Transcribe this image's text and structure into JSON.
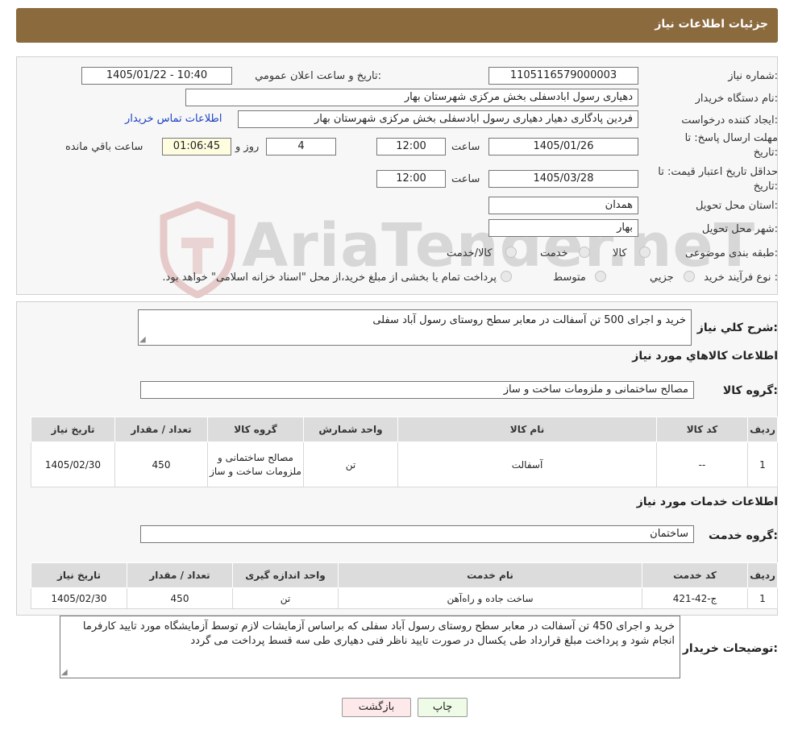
{
  "header": {
    "title": "جزئیات اطلاعات نیاز"
  },
  "watermark": {
    "text": "AriaTender.neT"
  },
  "form": {
    "need_number_label": "شماره نیاز:",
    "need_number": "1105116579000003",
    "announce_label": "تاریخ و ساعت اعلان عمومي:",
    "announce_value": "1405/01/22 - 10:40",
    "buyer_org_label": "نام دستگاه خریدار:",
    "buyer_org": "دهیاری رسول ابادسفلی بخش مرکزی شهرستان بهار",
    "requester_label": "ایجاد کننده درخواست:",
    "requester": "فردین پادگاری دهیار دهیاری رسول ابادسفلی بخش مرکزی شهرستان بهار",
    "contact_link": "اطلاعات تماس خریدار",
    "deadline_label_1": "مهلت ارسال پاسخ: تا",
    "deadline_label_2": "تاریخ:",
    "deadline_date": "1405/01/26",
    "time_word": "ساعت",
    "deadline_time": "12:00",
    "days_value": "4",
    "days_word": "روز و",
    "remaining_time": "01:06:45",
    "remaining_word": "ساعت باقي مانده",
    "validity_label_1": "حداقل تاریخ اعتبار قیمت: تا",
    "validity_label_2": "تاریخ:",
    "validity_date": "1405/03/28",
    "validity_time": "12:00",
    "province_label": "استان محل تحویل:",
    "province": "همدان",
    "city_label": "شهر محل تحویل:",
    "city": "بهار",
    "category_label": "طبقه بندی موضوعی:",
    "category_options": [
      "کالا",
      "خدمت",
      "کالا/خدمت"
    ],
    "process_label": "نوع فرآیند خرید :",
    "process_options": [
      "جزیي",
      "متوسط"
    ],
    "process_note": "پرداخت تمام یا بخشی از مبلغ خرید،از محل \"اسناد خزانه اسلامی\" خواهد بود."
  },
  "summary": {
    "label": "شرح کلي نیاز:",
    "text": "خرید و اجرای 500 تن آسفالت در معابر سطح روستای رسول آباد سفلی"
  },
  "goods": {
    "section_title": "اطلاعات کالاهاي مورد نیاز",
    "group_label": "گروه کالا:",
    "group_value": "مصالح ساختمانی و ملزومات ساخت و ساز",
    "headers": [
      "ردیف",
      "کد کالا",
      "نام کالا",
      "واحد شمارش",
      "گروه کالا",
      "تعداد / مقدار",
      "تاریخ نیاز"
    ],
    "rows": [
      [
        "1",
        "--",
        "آسفالت",
        "تن",
        "مصالح ساختمانی و ملزومات ساخت و ساز",
        "450",
        "1405/02/30"
      ]
    ]
  },
  "services": {
    "section_title": "اطلاعات خدمات مورد نیاز",
    "group_label": "گروه خدمت:",
    "group_value": "ساختمان",
    "headers": [
      "ردیف",
      "کد خدمت",
      "نام خدمت",
      "واحد اندازه گیری",
      "تعداد / مقدار",
      "تاریخ نیاز"
    ],
    "rows": [
      [
        "1",
        "ج-42-421",
        "ساخت جاده و راه‌آهن",
        "تن",
        "450",
        "1405/02/30"
      ]
    ]
  },
  "buyer_notes": {
    "label": "توضیحات خریدار:",
    "text": "خرید و اجرای 450 تن آسفالت در معابر سطح روستای رسول آباد سفلی که براساس آزمایشات لازم توسط آزمایشگاه مورد تایید کارفرما انجام شود و پرداخت مبلغ قرارداد طی یکسال در صورت تایید ناظر فنی دهیاری طی سه قسط پرداخت می گردد"
  },
  "buttons": {
    "print": "چاپ",
    "back": "بازگشت"
  },
  "colors": {
    "header_bg": "#8b6a3e",
    "print_bg": "#eefbe6",
    "back_bg": "#fde8ea",
    "link": "#1a3fc4"
  }
}
